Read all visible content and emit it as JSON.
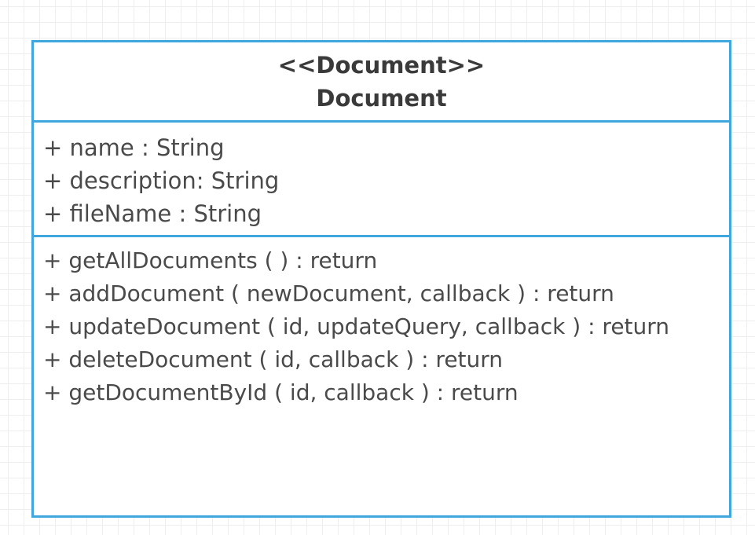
{
  "class_box": {
    "stereotype": "<<Document>>",
    "name": "Document",
    "attributes": [
      "+ name : String",
      "+ description: String",
      "+ fileName : String"
    ],
    "methods": [
      "+ getAllDocuments ( ) : return",
      "+ addDocument ( newDocument, callback ) : return",
      "+ updateDocument ( id, updateQuery, callback ) : return",
      "+ deleteDocument ( id, callback ) : return",
      "+ getDocumentById ( id, callback ) : return"
    ]
  },
  "colors": {
    "border": "#3fa7dd",
    "text": "#4a4a4a",
    "grid": "#eeeeee"
  }
}
